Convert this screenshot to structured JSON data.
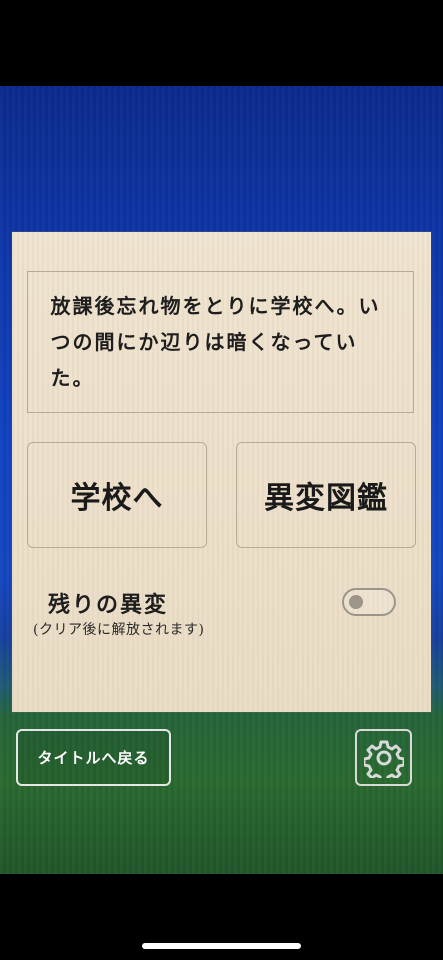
{
  "story": {
    "text": "放課後忘れ物をとりに学校へ。いつの間にか辺りは暗くなっていた。"
  },
  "buttons": {
    "school": "学校へ",
    "catalog": "異変図鑑",
    "back_to_title": "タイトルへ戻る"
  },
  "remaining": {
    "label": "残りの異変",
    "note": "(クリア後に解放されます)",
    "toggle_enabled": false
  },
  "icons": {
    "settings": "gear-icon"
  },
  "colors": {
    "panel": "#ecdfc9",
    "border": "#b9ab95",
    "sky": "#1142c0",
    "grass": "#2a6a30"
  }
}
